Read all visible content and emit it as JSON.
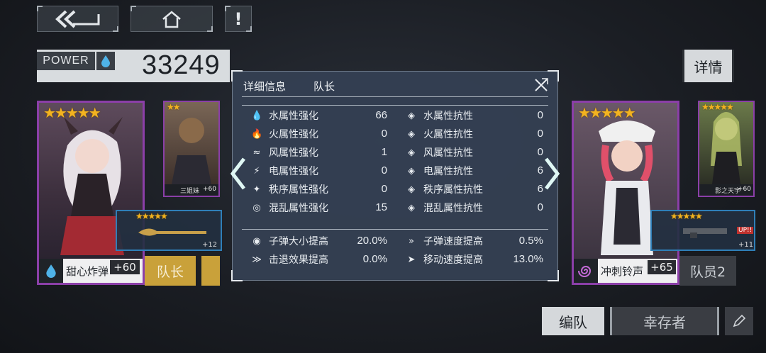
{
  "nav": {
    "back_icon": "double-chevron-left-icon",
    "home_icon": "home-icon",
    "alert_label": "!"
  },
  "power": {
    "label": "POWER",
    "value": "33249"
  },
  "detail_button": "详情",
  "left_card": {
    "stars": "★★★★★",
    "name": "甜心炸弹",
    "plus": "+60",
    "element_icon": "water-drop-icon",
    "weapon": {
      "stars": "★★★★★",
      "plus": "+12"
    },
    "role": "队长"
  },
  "left_small_card": {
    "stars": "★★",
    "name": "三姐妹",
    "plus": "+60"
  },
  "right_card": {
    "stars": "★★★★★",
    "name": "冲刺铃声",
    "plus": "+65",
    "element_icon": "spiral-icon",
    "weapon": {
      "stars": "★★★★★",
      "plus": "+11",
      "badge": "UP!!"
    },
    "role": "队员2"
  },
  "right_small_card": {
    "stars": "★★★★★",
    "name": "影之天宇",
    "plus": "+60"
  },
  "modal": {
    "title": "详细信息",
    "subtitle": "队长",
    "attributes": [
      {
        "icon": "water-icon",
        "label": "水属性强化",
        "value": "66",
        "res_icon": "water-shield-icon",
        "res_label": "水属性抗性",
        "res_value": "0"
      },
      {
        "icon": "fire-icon",
        "label": "火属性强化",
        "value": "0",
        "res_icon": "fire-shield-icon",
        "res_label": "火属性抗性",
        "res_value": "0"
      },
      {
        "icon": "wind-icon",
        "label": "风属性强化",
        "value": "1",
        "res_icon": "wind-shield-icon",
        "res_label": "风属性抗性",
        "res_value": "0"
      },
      {
        "icon": "lightning-icon",
        "label": "电属性强化",
        "value": "0",
        "res_icon": "lightning-shield-icon",
        "res_label": "电属性抗性",
        "res_value": "6"
      },
      {
        "icon": "order-icon",
        "label": "秩序属性强化",
        "value": "0",
        "res_icon": "order-shield-icon",
        "res_label": "秩序属性抗性",
        "res_value": "6"
      },
      {
        "icon": "chaos-icon",
        "label": "混乱属性强化",
        "value": "15",
        "res_icon": "chaos-shield-icon",
        "res_label": "混乱属性抗性",
        "res_value": "0"
      }
    ],
    "bonuses": [
      {
        "icon": "bullet-size-icon",
        "label": "子弹大小提高",
        "value": "20.0%",
        "icon2": "bullet-speed-icon",
        "label2": "子弹速度提高",
        "value2": "0.5%"
      },
      {
        "icon": "knockback-icon",
        "label": "击退效果提高",
        "value": "0.0%",
        "icon2": "move-speed-icon",
        "label2": "移动速度提高",
        "value2": "13.0%"
      }
    ]
  },
  "bottom": {
    "team_label": "编队",
    "survivor_label": "幸存者",
    "edit_icon": "pencil-icon"
  },
  "colors": {
    "accent": "#5fd0c8",
    "card_border": "#8b3fa8",
    "gold": "#c9a13a"
  }
}
